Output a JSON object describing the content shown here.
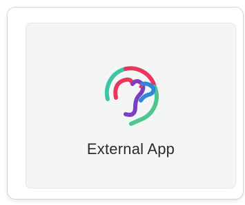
{
  "app": {
    "label": "External App",
    "icon": "dog-head-logo-icon"
  },
  "colors": {
    "card_border": "#d6d6d6",
    "tile_background": "#f4f6f6",
    "label_text": "#2b2b2b",
    "logo_teal": "#3cc6a5",
    "logo_red": "#e8365d",
    "logo_purple": "#7b3fc4",
    "logo_blue": "#2f87d8",
    "logo_green": "#4cc78f"
  }
}
